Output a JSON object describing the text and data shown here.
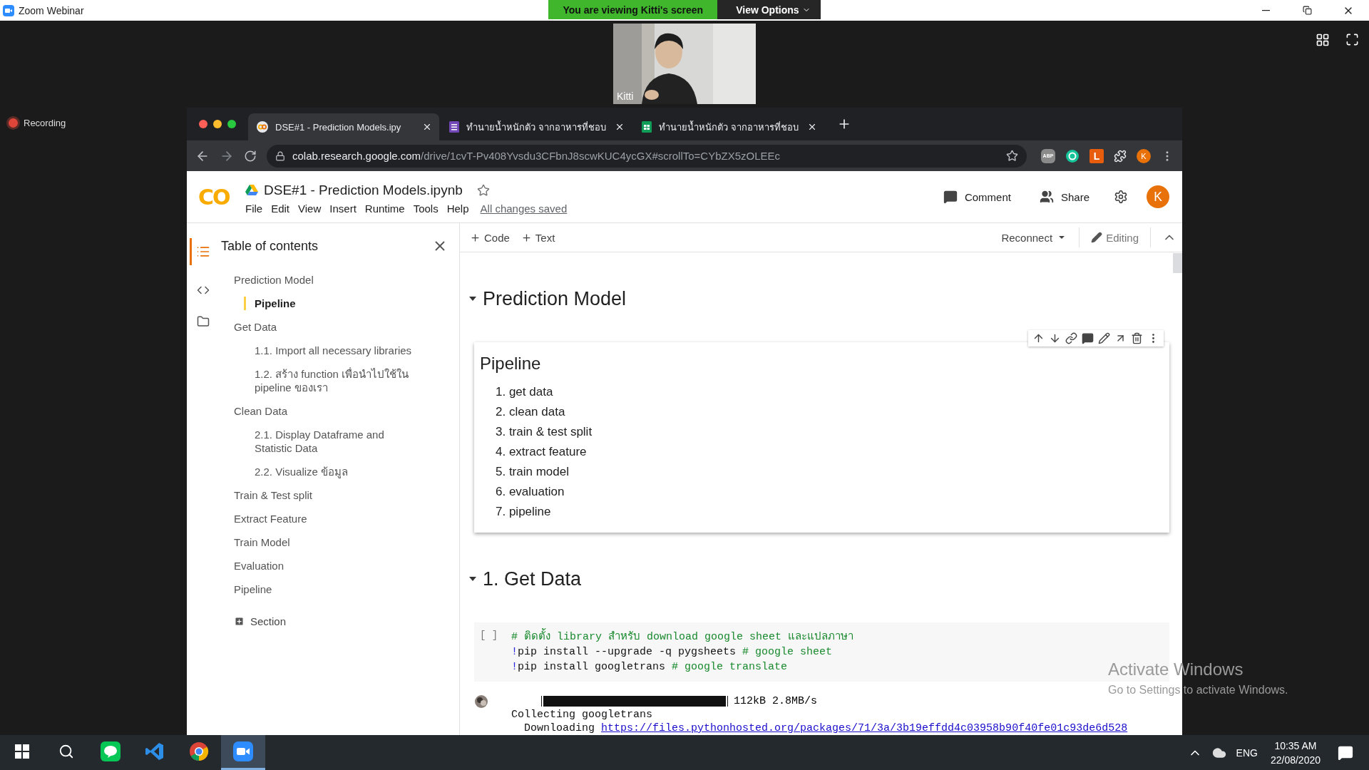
{
  "zoom": {
    "title": "Zoom Webinar",
    "banner": "You are viewing Kitti's screen",
    "view_options": "View Options",
    "participant": {
      "name": "Kitti"
    },
    "recording": "Recording"
  },
  "browser": {
    "tabs": [
      {
        "kind": "colab",
        "title": "DSE#1 - Prediction Models.ipy",
        "selected": true
      },
      {
        "kind": "forms",
        "title": "ทำนายน้ำหนักตัว จากอาหารที่ชอบ",
        "selected": false
      },
      {
        "kind": "sheets",
        "title": "ทำนายน้ำหนักตัว จากอาหารที่ชอบ",
        "selected": false
      }
    ],
    "url": {
      "host": "colab.research.google.com",
      "path": "/drive/1cvT-Pv408Yvsdu3CFbnJ8scwKUC4ycGX#scrollTo=CYbZX5zOLEEc"
    },
    "extensions": [
      {
        "kind": "adblock",
        "label": "ABP"
      },
      {
        "kind": "grammarly"
      },
      {
        "kind": "letter",
        "label": "L"
      },
      {
        "kind": "puzzle"
      }
    ],
    "profile": "K"
  },
  "colab": {
    "logo": "CO",
    "title": "DSE#1 - Prediction Models.ipynb",
    "menu": [
      "File",
      "Edit",
      "View",
      "Insert",
      "Runtime",
      "Tools",
      "Help"
    ],
    "save_status": "All changes saved",
    "actions": [
      {
        "kind": "comment",
        "label": "Comment"
      },
      {
        "kind": "share",
        "label": "Share"
      }
    ],
    "avatar": "K",
    "toolbar": {
      "add": [
        "Code",
        "Text"
      ],
      "runtime": "Reconnect",
      "mode": "Editing"
    },
    "toc": {
      "title": "Table of contents",
      "items": [
        {
          "label": "Prediction Model",
          "selected": false,
          "children": [
            {
              "label": "Pipeline",
              "selected": true
            }
          ]
        },
        {
          "label": "Get Data",
          "selected": false,
          "children": [
            {
              "label": "1.1. Import all necessary libraries",
              "selected": false
            },
            {
              "label": "1.2. สร้าง function เพื่อนำไปใช้ใน pipeline ของเรา",
              "selected": false
            }
          ]
        },
        {
          "label": "Clean Data",
          "selected": false,
          "children": [
            {
              "label": "2.1. Display Dataframe and Statistic Data",
              "selected": false
            },
            {
              "label": "2.2. Visualize ข้อมูล",
              "selected": false
            }
          ]
        },
        {
          "label": "Train & Test split",
          "selected": false
        },
        {
          "label": "Extract Feature",
          "selected": false
        },
        {
          "label": "Train Model",
          "selected": false
        },
        {
          "label": "Evaluation",
          "selected": false
        },
        {
          "label": "Pipeline",
          "selected": false
        }
      ],
      "add_section": "Section"
    },
    "cells": [
      {
        "kind": "heading",
        "text": "Prediction Model",
        "expanded": true
      },
      {
        "kind": "text",
        "title": "Pipeline",
        "selected": true,
        "list": [
          "1. get data",
          "2. clean data",
          "3. train & test split",
          "4. extract feature",
          "5. train model",
          "6. evaluation",
          "7. pipeline"
        ]
      },
      {
        "kind": "heading",
        "text": "1. Get Data",
        "expanded": true
      },
      {
        "kind": "code",
        "prompt": "[ ]",
        "lines": [
          [
            {
              "kind": "comment",
              "text": "# ติดตั้ง library สำหรับ download google sheet และแปลภาษา"
            }
          ],
          [
            {
              "kind": "bang",
              "text": "!"
            },
            {
              "kind": "plain",
              "text": "pip install --upgrade -q pygsheets "
            },
            {
              "kind": "comment",
              "text": "# google sheet"
            }
          ],
          [
            {
              "kind": "bang",
              "text": "!"
            },
            {
              "kind": "plain",
              "text": "pip install googletrans "
            },
            {
              "kind": "comment",
              "text": "# google translate"
            }
          ]
        ]
      },
      {
        "kind": "output",
        "progress": {
          "level": 1,
          "reading": "112kB 2.8MB/s"
        },
        "lines": [
          [
            {
              "kind": "plain",
              "text": "Collecting googletrans"
            }
          ],
          [
            {
              "kind": "plain",
              "text": "  Downloading "
            },
            {
              "kind": "link",
              "text": "https://files.pythonhosted.org/packages/71/3a/3b19effdd4c03958b90f40fe01c93de6d528"
            }
          ]
        ]
      }
    ]
  },
  "taskbar": {
    "apps": [
      {
        "kind": "line",
        "selected": false
      },
      {
        "kind": "vscode",
        "selected": false
      },
      {
        "kind": "chrome",
        "selected": false
      },
      {
        "kind": "zoom",
        "selected": true
      }
    ],
    "language": "ENG",
    "time": "10:35 AM",
    "date": "22/08/2020"
  },
  "activation": {
    "title": "Activate Windows",
    "hint": "Go to Settings to activate Windows."
  }
}
